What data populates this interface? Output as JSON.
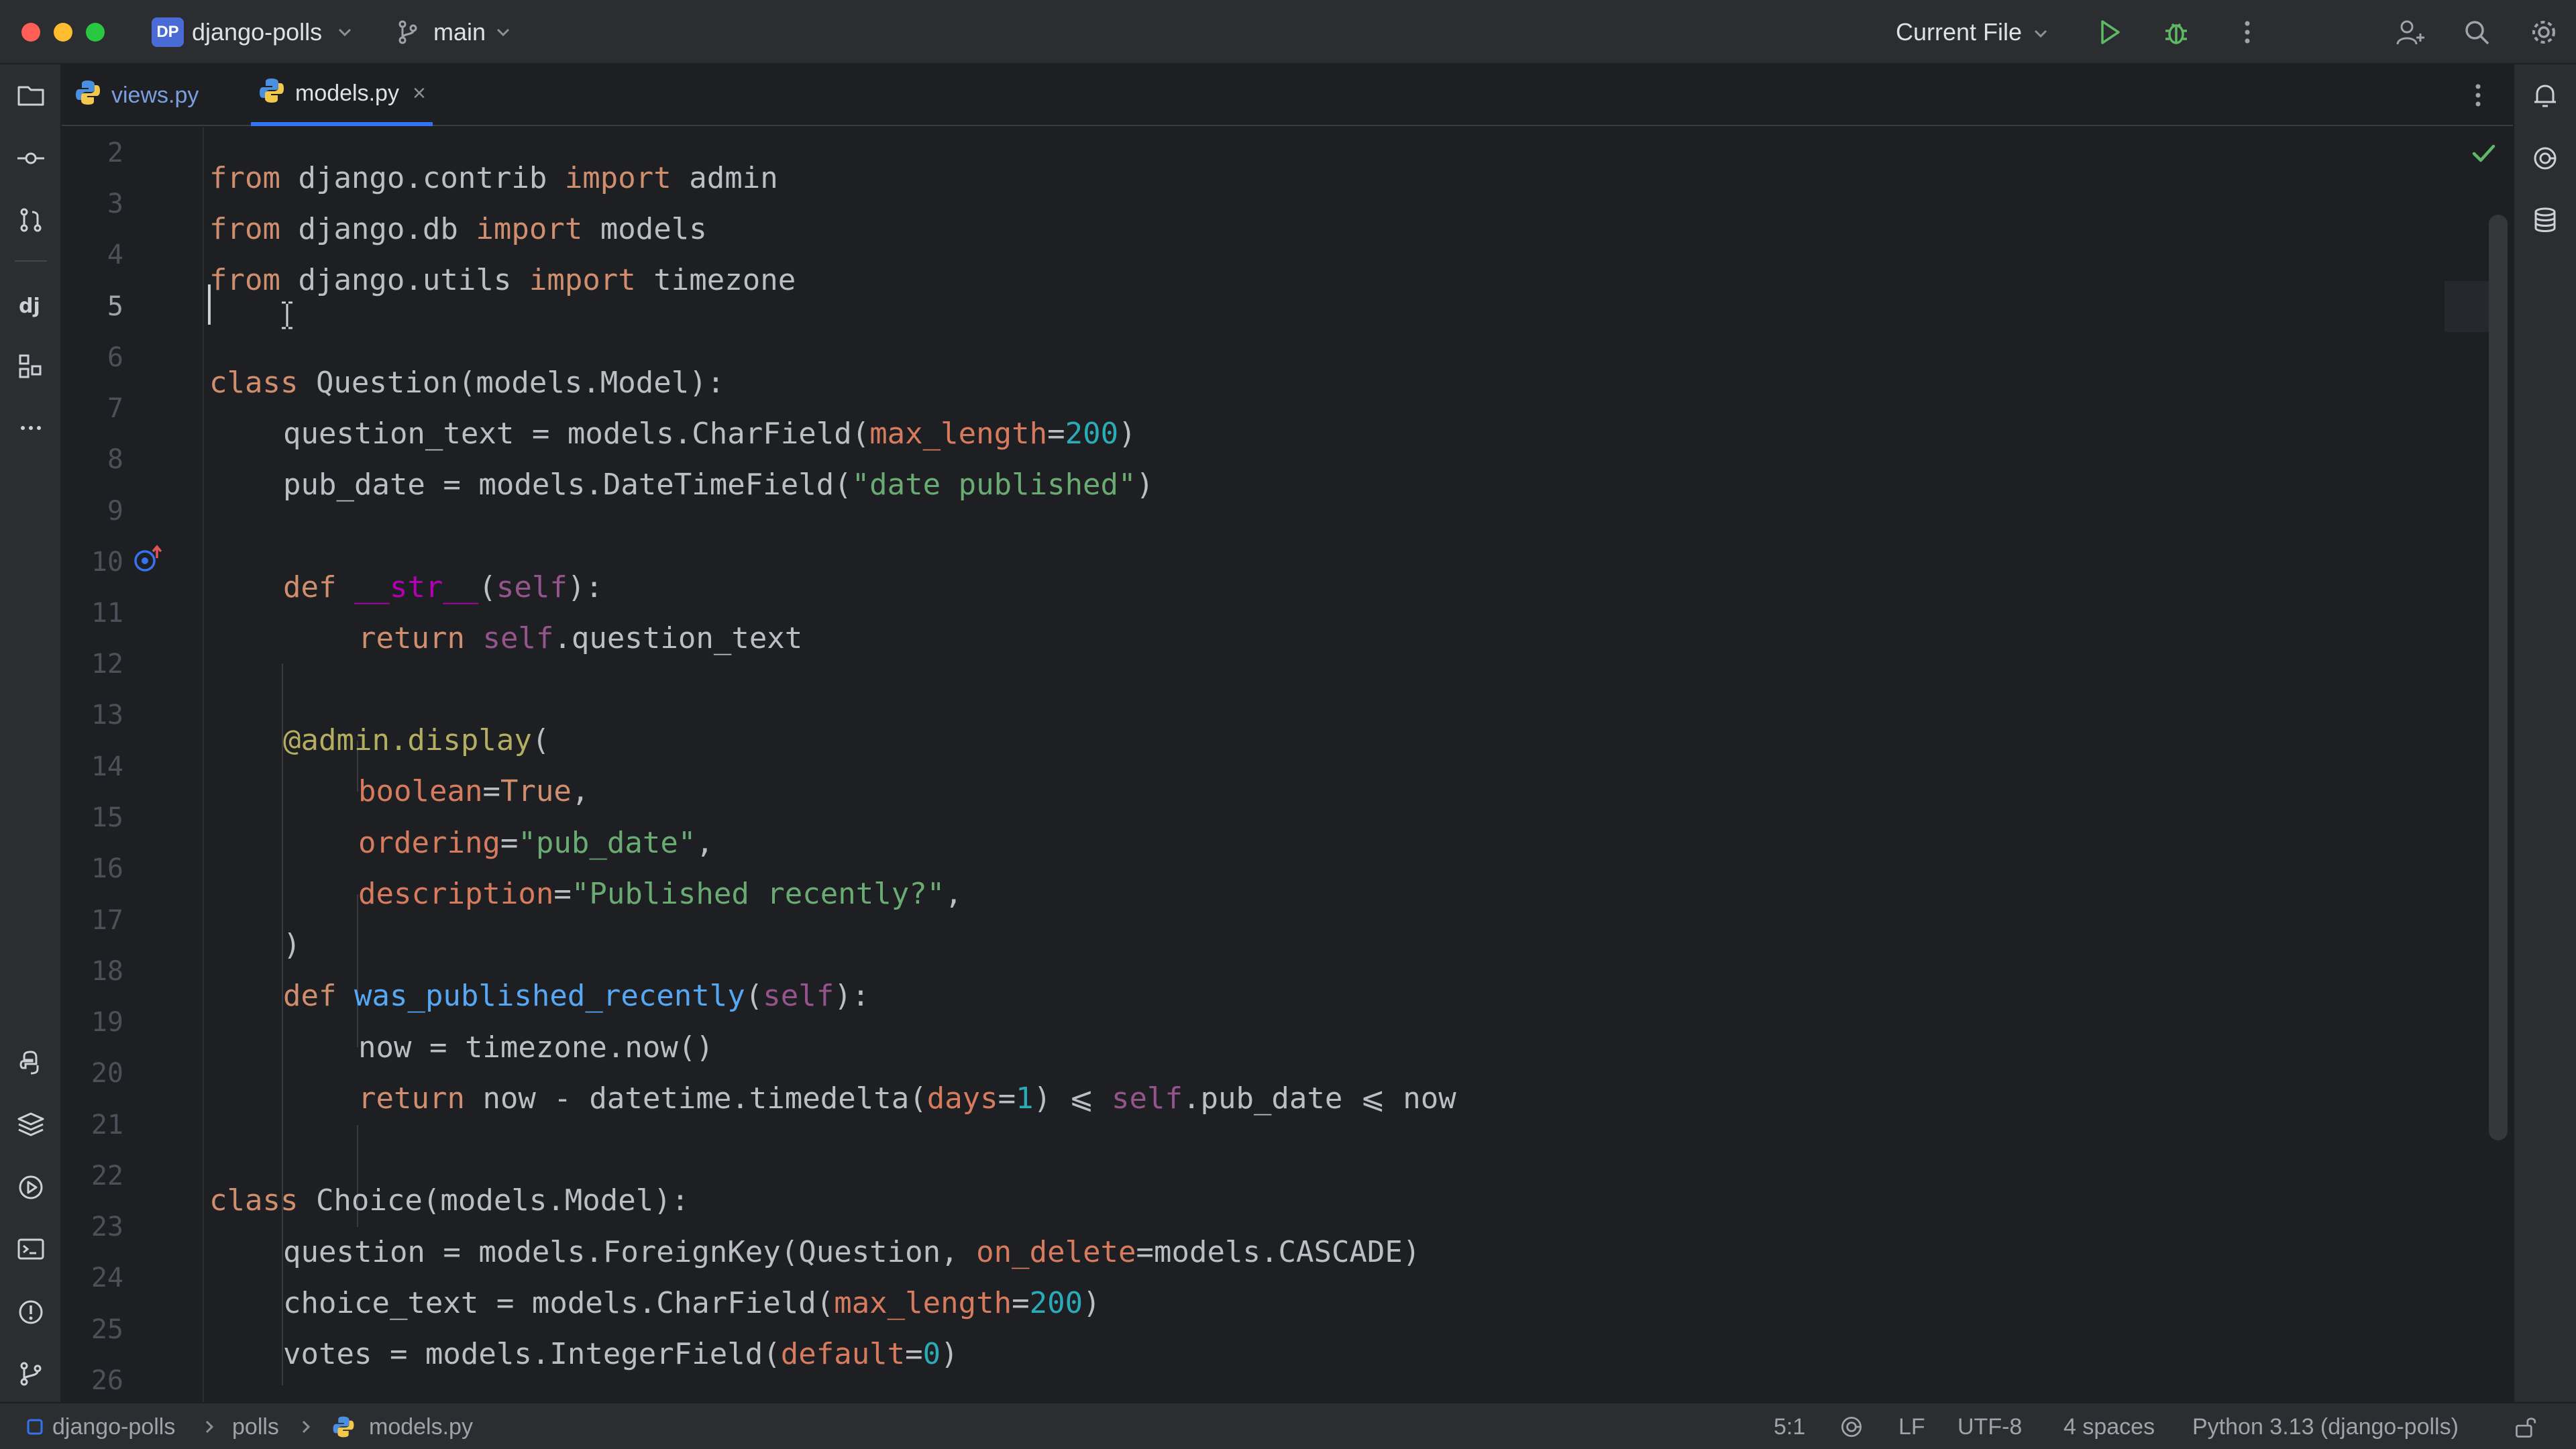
{
  "titlebar": {
    "project_badge": "DP",
    "project_name": "django-polls",
    "branch": "main",
    "run_config": "Current File"
  },
  "tabs": [
    {
      "label": "views.py",
      "active": false
    },
    {
      "label": "models.py",
      "active": true,
      "close": "×"
    }
  ],
  "editor": {
    "line_numbers": [
      "2",
      "3",
      "4",
      "5",
      "6",
      "7",
      "8",
      "9",
      "10",
      "11",
      "12",
      "13",
      "14",
      "15",
      "16",
      "17",
      "18",
      "19",
      "20",
      "21",
      "22",
      "23",
      "24",
      "25",
      "26"
    ],
    "current_line": "5",
    "code": {
      "l2": [
        "from",
        " django.contrib ",
        "import",
        " admin"
      ],
      "l3": [
        "from",
        " django.db ",
        "import",
        " models"
      ],
      "l4": [
        "from",
        " django.utils ",
        "import",
        " timezone"
      ],
      "l6": [
        "class",
        " Question(models.Model):"
      ],
      "l7": [
        "question_text = models.CharField(",
        "max_length",
        "=",
        "200",
        ")"
      ],
      "l8": [
        "pub_date = models.DateTimeField(",
        "\"date published\"",
        ")"
      ],
      "l10": [
        "def",
        " ",
        "__str__",
        "(",
        "self",
        "):"
      ],
      "l11": [
        "return",
        " ",
        "self",
        ".question_text"
      ],
      "l13": [
        "@admin.display",
        "("
      ],
      "l14": [
        "boolean",
        "=",
        "True",
        ","
      ],
      "l15": [
        "ordering",
        "=",
        "\"pub_date\"",
        ","
      ],
      "l16": [
        "description",
        "=",
        "\"Published recently?\"",
        ","
      ],
      "l17": [
        ")"
      ],
      "l18": [
        "def",
        " ",
        "was_published_recently",
        "(",
        "self",
        "):"
      ],
      "l19": [
        "now = timezone.now()"
      ],
      "l20": [
        "return",
        " now - datetime.timedelta(",
        "days",
        "=",
        "1",
        ") ⩽ ",
        "self",
        ".pub_date ⩽ now"
      ],
      "l22": [
        "class",
        " Choice(models.Model):"
      ],
      "l23": [
        "question = models.ForeignKey(Question, ",
        "on_delete",
        "=models.CASCADE)"
      ],
      "l24": [
        "choice_text = models.CharField(",
        "max_length",
        "=",
        "200",
        ")"
      ],
      "l25": [
        "votes = models.IntegerField(",
        "default",
        "=",
        "0",
        ")"
      ]
    }
  },
  "statusbar": {
    "breadcrumb": [
      "django-polls",
      "polls",
      "models.py"
    ],
    "position": "5:1",
    "line_separator": "LF",
    "encoding": "UTF-8",
    "indent": "4 spaces",
    "interpreter": "Python 3.13 (django-polls)"
  },
  "colors": {
    "keyword": "#cf8e6d",
    "function": "#56a8f5",
    "string": "#6aab73",
    "number": "#2aacb8",
    "parameter": "#d77b5f",
    "self": "#94558d",
    "decorator": "#b3ae60",
    "accent": "#3574f0"
  },
  "icons": {
    "titlebar": [
      "branch-icon",
      "run-icon",
      "debug-icon",
      "more-icon",
      "add-user-icon",
      "search-icon",
      "settings-icon"
    ],
    "left_strip": [
      "project-icon",
      "commit-icon",
      "pull-requests-icon",
      "django-icon",
      "structure-icon",
      "more-tools-icon",
      "python-console-icon",
      "layers-icon",
      "services-icon",
      "terminal-icon",
      "problems-icon",
      "git-icon"
    ],
    "right_strip": [
      "notifications-icon",
      "ai-assistant-icon",
      "database-icon"
    ]
  }
}
